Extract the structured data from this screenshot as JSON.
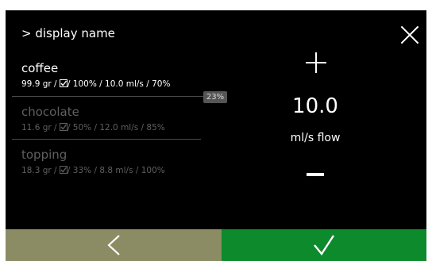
{
  "header": {
    "title": "> display name"
  },
  "ingredients": [
    {
      "name": "coffee",
      "detail_pre": "99.9 gr / ",
      "detail_post": "/ 100% / 10.0 ml/s / 70%"
    },
    {
      "name": "chocolate",
      "detail_pre": "11.6 gr / ",
      "detail_post": "/ 50% / 12.0 ml/s / 85%"
    },
    {
      "name": "topping",
      "detail_pre": "18.3 gr / ",
      "detail_post": "/ 33% / 8.8 ml/s / 100%"
    }
  ],
  "badge": "23%",
  "flow": {
    "value": "10.0",
    "unit": "ml/s flow"
  },
  "icons": {
    "close": "close-icon",
    "plus": "plus-icon",
    "minus": "minus-icon",
    "checkbox": "checkbox-checked-icon",
    "back": "chevron-left-icon",
    "confirm": "checkmark-icon"
  },
  "colors": {
    "background": "#000000",
    "active_text": "#ffffff",
    "inactive_text": "#5f5f5f",
    "back_button": "#8c8c64",
    "confirm_button": "#0d8a2c"
  }
}
